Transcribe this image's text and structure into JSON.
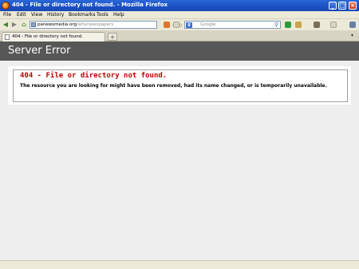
{
  "window": {
    "title": "404 - File or directory not found. - Mozilla Firefox"
  },
  "menu": [
    "File",
    "Edit",
    "View",
    "History",
    "Bookmarks",
    "Tools",
    "Help"
  ],
  "navbar": {
    "url_domain": "panewsmedia.org",
    "url_path": "/whynewspapers",
    "search_placeholder": "Google",
    "search_engine_icon": "google-icon"
  },
  "tab": {
    "label": "404 - File or directory not found.",
    "newtab_label": "+"
  },
  "page": {
    "header": "Server Error",
    "error_title": "404 - File or directory not found.",
    "error_description": "The resource you are looking for might have been removed, had its name changed, or is temporarily unavailable."
  },
  "colors": {
    "titlebar": "#1b4fc2",
    "header_bg": "#575757",
    "error_red": "#c00000"
  }
}
